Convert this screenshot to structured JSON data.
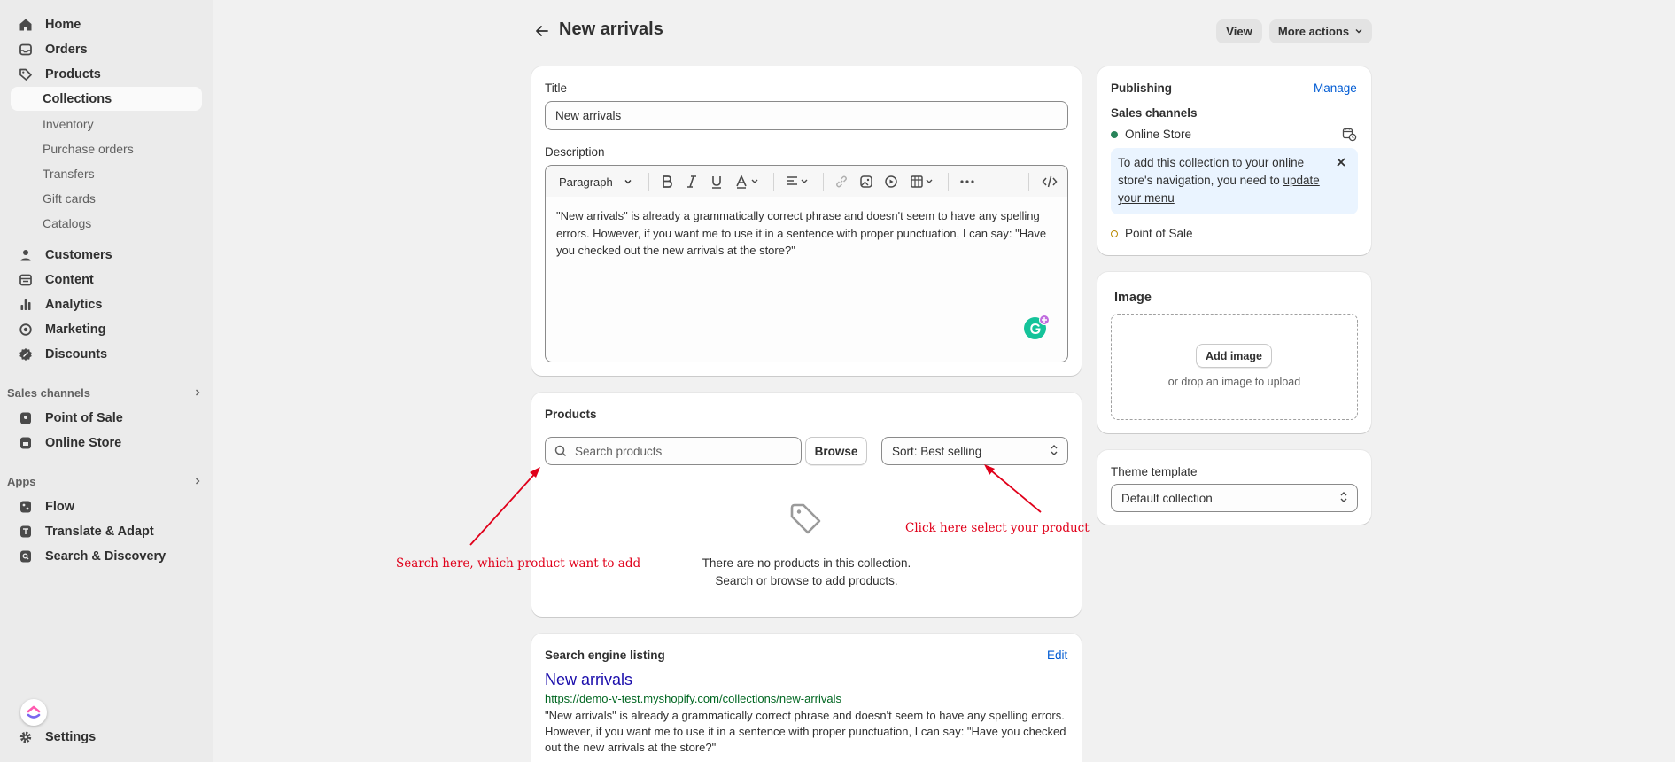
{
  "sidebar": {
    "items": [
      {
        "label": "Home",
        "icon": "home-icon"
      },
      {
        "label": "Orders",
        "icon": "inbox-icon"
      },
      {
        "label": "Products",
        "icon": "tag-icon"
      },
      {
        "label": "Collections"
      },
      {
        "label": "Inventory"
      },
      {
        "label": "Purchase orders"
      },
      {
        "label": "Transfers"
      },
      {
        "label": "Gift cards"
      },
      {
        "label": "Catalogs"
      },
      {
        "label": "Customers",
        "icon": "person-icon"
      },
      {
        "label": "Content",
        "icon": "content-icon"
      },
      {
        "label": "Analytics",
        "icon": "bar-chart-icon"
      },
      {
        "label": "Marketing",
        "icon": "target-icon"
      },
      {
        "label": "Discounts",
        "icon": "discount-icon"
      }
    ],
    "sales_channels_heading": "Sales channels",
    "sales_channels": [
      {
        "label": "Point of Sale",
        "icon": "pos-icon"
      },
      {
        "label": "Online Store",
        "icon": "store-icon"
      }
    ],
    "apps_heading": "Apps",
    "apps": [
      {
        "label": "Flow",
        "icon": "flow-icon"
      },
      {
        "label": "Translate & Adapt",
        "icon": "translate-icon"
      },
      {
        "label": "Search & Discovery",
        "icon": "search-discovery-icon"
      }
    ],
    "settings_label": "Settings"
  },
  "header": {
    "title": "New arrivals",
    "view_label": "View",
    "more_actions_label": "More actions"
  },
  "details": {
    "title_label": "Title",
    "title_value": "New arrivals",
    "description_label": "Description",
    "paragraph_select": "Paragraph",
    "description_text": "\"New arrivals\" is already a grammatically correct phrase and doesn't seem to have any spelling errors. However, if you want me to use it in a sentence with proper punctuation, I can say: \"Have you checked out the new arrivals at the store?\""
  },
  "products": {
    "heading": "Products",
    "search_placeholder": "Search products",
    "browse_label": "Browse",
    "sort_label": "Sort: Best selling",
    "empty_line1": "There are no products in this collection.",
    "empty_line2": "Search or browse to add products."
  },
  "seo": {
    "heading": "Search engine listing",
    "edit_label": "Edit",
    "page_title": "New arrivals",
    "url": "https://demo-v-test.myshopify.com/collections/new-arrivals",
    "description": "\"New arrivals\" is already a grammatically correct phrase and doesn't seem to have any spelling errors. However, if you want me to use it in a sentence with proper punctuation, I can say: \"Have you checked out the new arrivals at the store?\""
  },
  "publishing": {
    "heading": "Publishing",
    "manage_label": "Manage",
    "sales_channels_label": "Sales channels",
    "online_store": "Online Store",
    "banner_text": "To add this collection to your online store's navigation, you need to",
    "banner_link": "update your menu",
    "point_of_sale": "Point of Sale",
    "online_store_status_color": "#29845a",
    "pos_status_color": "#b98900"
  },
  "image": {
    "heading": "Image",
    "add_label": "Add image",
    "drop_hint": "or drop an image to upload"
  },
  "theme": {
    "label": "Theme template",
    "value": "Default collection"
  },
  "annotations": {
    "search_hint": "Search here, which product want to add",
    "sort_hint": "Click here select your product",
    "color": "#e0001a"
  }
}
